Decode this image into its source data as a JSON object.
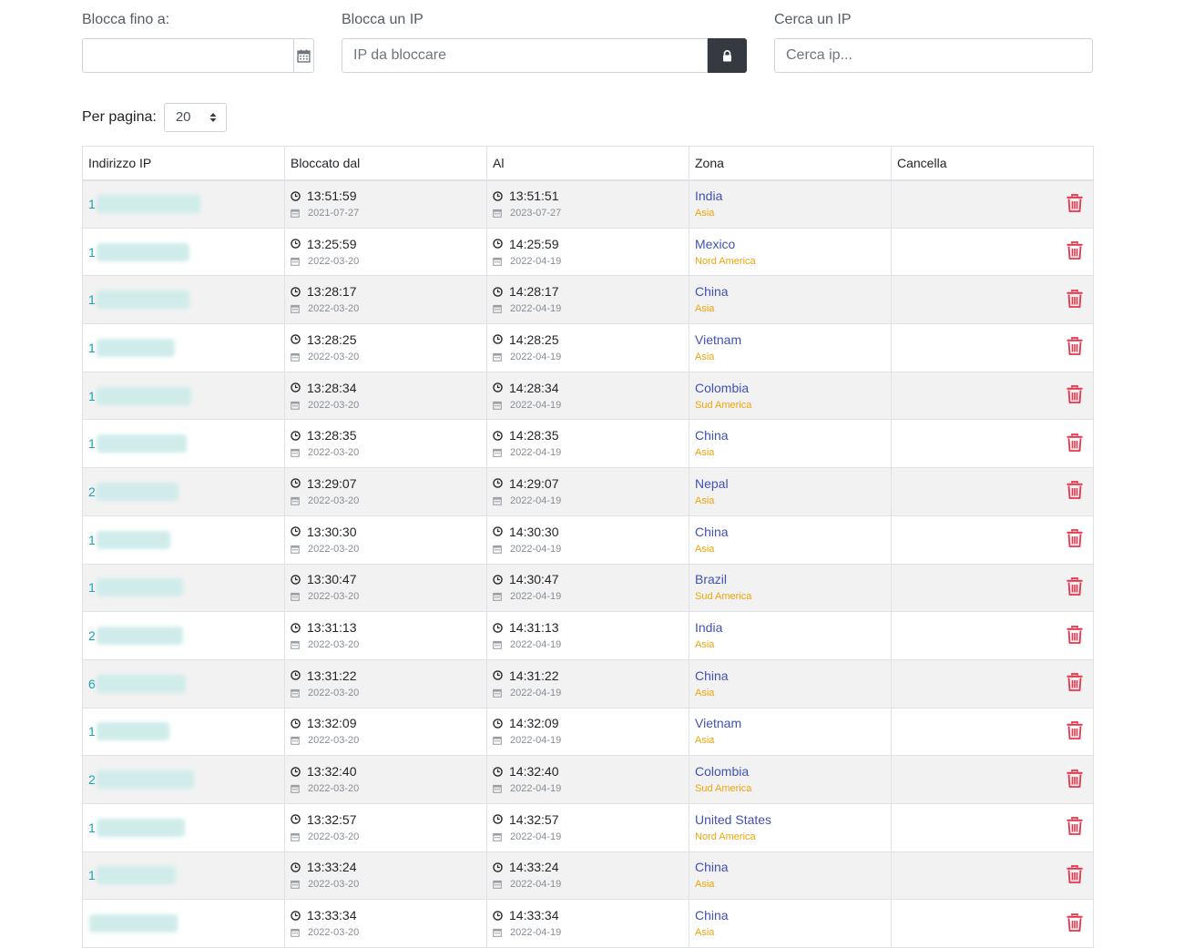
{
  "filters": {
    "block_until_label": "Blocca fino a:",
    "block_until_value": "",
    "block_ip_label": "Blocca un IP",
    "block_ip_placeholder": "IP da bloccare",
    "search_ip_label": "Cerca un IP",
    "search_ip_placeholder": "Cerca ip..."
  },
  "paging": {
    "per_page_label": "Per pagina:",
    "per_page_value": "20"
  },
  "table": {
    "headers": [
      "Indirizzo IP",
      "Bloccato dal",
      "Al",
      "Zona",
      "Cancella"
    ],
    "rows": [
      {
        "ip": "1",
        "blur": 114,
        "from_time": "13:51:59",
        "from_date": "2021-07-27",
        "to_time": "13:51:51",
        "to_date": "2023-07-27",
        "country": "India",
        "continent": "Asia"
      },
      {
        "ip": "1",
        "blur": 102,
        "from_time": "13:25:59",
        "from_date": "2022-03-20",
        "to_time": "14:25:59",
        "to_date": "2022-04-19",
        "country": "Mexico",
        "continent": "Nord America"
      },
      {
        "ip": "1",
        "blur": 102,
        "from_time": "13:28:17",
        "from_date": "2022-03-20",
        "to_time": "14:28:17",
        "to_date": "2022-04-19",
        "country": "China",
        "continent": "Asia"
      },
      {
        "ip": "1",
        "blur": 86,
        "from_time": "13:28:25",
        "from_date": "2022-03-20",
        "to_time": "14:28:25",
        "to_date": "2022-04-19",
        "country": "Vietnam",
        "continent": "Asia"
      },
      {
        "ip": "1",
        "blur": 104,
        "from_time": "13:28:34",
        "from_date": "2022-03-20",
        "to_time": "14:28:34",
        "to_date": "2022-04-19",
        "country": "Colombia",
        "continent": "Sud America"
      },
      {
        "ip": "1",
        "blur": 99,
        "from_time": "13:28:35",
        "from_date": "2022-03-20",
        "to_time": "14:28:35",
        "to_date": "2022-04-19",
        "country": "China",
        "continent": "Asia"
      },
      {
        "ip": "2",
        "blur": 90,
        "from_time": "13:29:07",
        "from_date": "2022-03-20",
        "to_time": "14:29:07",
        "to_date": "2022-04-19",
        "country": "Nepal",
        "continent": "Asia"
      },
      {
        "ip": "1",
        "blur": 81,
        "from_time": "13:30:30",
        "from_date": "2022-03-20",
        "to_time": "14:30:30",
        "to_date": "2022-04-19",
        "country": "China",
        "continent": "Asia"
      },
      {
        "ip": "1",
        "blur": 95,
        "from_time": "13:30:47",
        "from_date": "2022-03-20",
        "to_time": "14:30:47",
        "to_date": "2022-04-19",
        "country": "Brazil",
        "continent": "Sud America"
      },
      {
        "ip": "2",
        "blur": 95,
        "from_time": "13:31:13",
        "from_date": "2022-03-20",
        "to_time": "14:31:13",
        "to_date": "2022-04-19",
        "country": "India",
        "continent": "Asia"
      },
      {
        "ip": "6",
        "blur": 98,
        "from_time": "13:31:22",
        "from_date": "2022-03-20",
        "to_time": "14:31:22",
        "to_date": "2022-04-19",
        "country": "China",
        "continent": "Asia"
      },
      {
        "ip": "1",
        "blur": 80,
        "from_time": "13:32:09",
        "from_date": "2022-03-20",
        "to_time": "14:32:09",
        "to_date": "2022-04-19",
        "country": "Vietnam",
        "continent": "Asia"
      },
      {
        "ip": "2",
        "blur": 107,
        "from_time": "13:32:40",
        "from_date": "2022-03-20",
        "to_time": "14:32:40",
        "to_date": "2022-04-19",
        "country": "Colombia",
        "continent": "Sud America"
      },
      {
        "ip": "1",
        "blur": 97,
        "from_time": "13:32:57",
        "from_date": "2022-03-20",
        "to_time": "14:32:57",
        "to_date": "2022-04-19",
        "country": "United States",
        "continent": "Nord America"
      },
      {
        "ip": "1",
        "blur": 87,
        "from_time": "13:33:24",
        "from_date": "2022-03-20",
        "to_time": "14:33:24",
        "to_date": "2022-04-19",
        "country": "China",
        "continent": "Asia"
      },
      {
        "ip": "",
        "blur": 97,
        "from_time": "13:33:34",
        "from_date": "2022-03-20",
        "to_time": "14:33:34",
        "to_date": "2022-04-19",
        "country": "China",
        "continent": "Asia"
      }
    ]
  },
  "colors": {
    "ip_text": "#17a2b8",
    "country_link": "#3f51b5",
    "continent_text": "#f0a30a",
    "delete_icon": "#e8354b",
    "lock_button_bg": "#343a40"
  },
  "icons": {
    "calendar": "calendar-icon",
    "lock": "lock-icon",
    "sort": "sort-arrows-icon",
    "clock": "clock-icon",
    "trash": "trash-icon"
  }
}
